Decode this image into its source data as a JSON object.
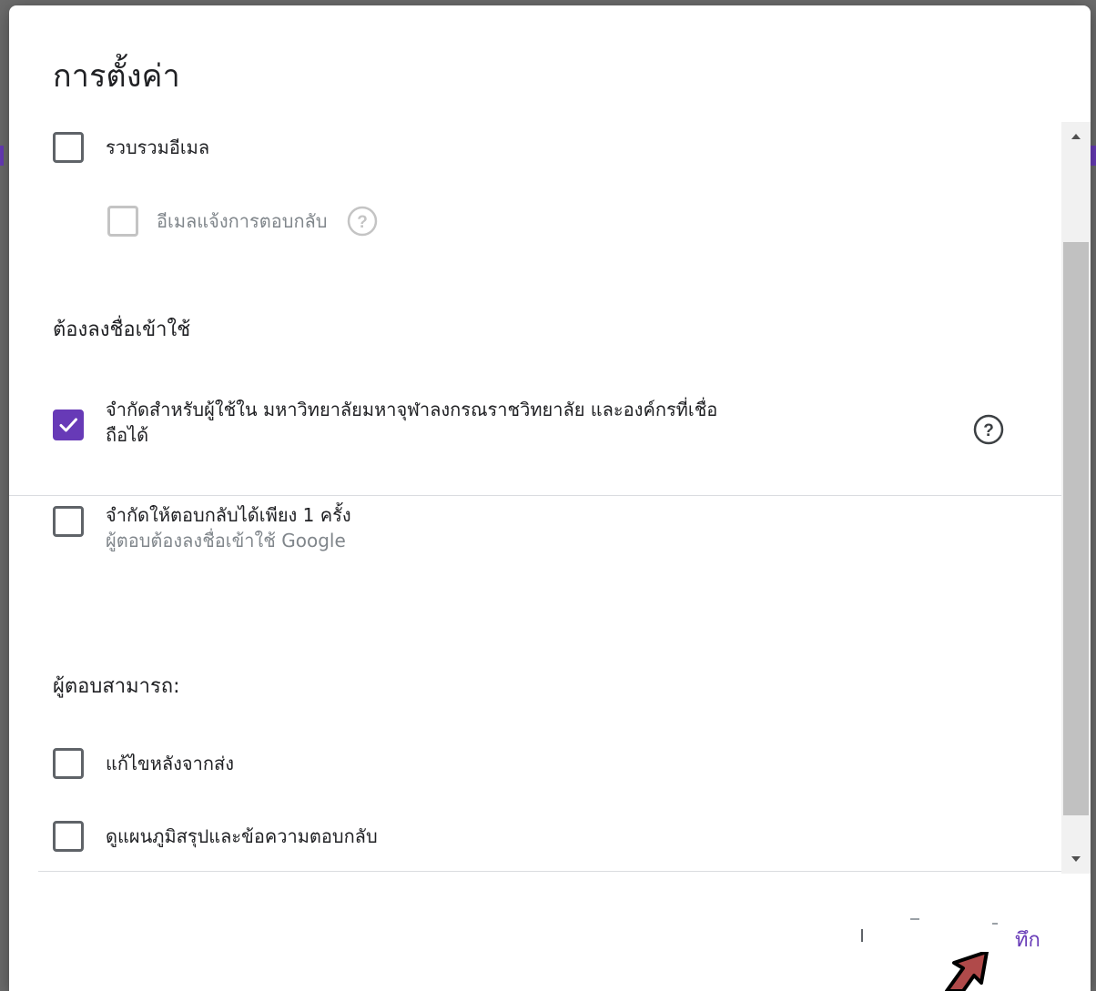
{
  "dialog": {
    "title": "การตั้งค่า"
  },
  "options": {
    "collect_emails": {
      "label": "รวบรวมอีเมล",
      "checked": false
    },
    "response_receipts": {
      "label": "อีเมลแจ้งการตอบกลับ",
      "checked": false,
      "disabled": true
    },
    "requires_sign_in_heading": "ต้องลงชื่อเข้าใช้",
    "restrict_users": {
      "label_line1": "จำกัดสำหรับผู้ใช้ใน มหาวิทยาลัยมหาจุฬาลงกรณราชวิทยาลัย และองค์กรที่เชื่อ",
      "label_line2": "ถือได้",
      "checked": true
    },
    "limit_one_response": {
      "label": "จำกัดให้ตอบกลับได้เพียง 1 ครั้ง",
      "sublabel": "ผู้ตอบต้องลงชื่อเข้าใช้ Google",
      "checked": false
    },
    "respondents_can_heading": "ผู้ตอบสามารถ:",
    "edit_after_submit": {
      "label": "แก้ไขหลังจากส่ง",
      "checked": false
    },
    "see_summary": {
      "label": "ดูแผนภูมิสรุปและข้อความตอบกลับ",
      "checked": false
    }
  },
  "footer": {
    "save_label": "ทึก"
  },
  "icons": {
    "help": "help-circle-icon",
    "check": "check-icon",
    "scroll_up": "arrow-up-icon",
    "scroll_down": "arrow-down-icon",
    "cursor": "cursor-arrow-icon"
  },
  "colors": {
    "accent": "#673ab7",
    "text": "#202124",
    "muted": "#80868b"
  }
}
